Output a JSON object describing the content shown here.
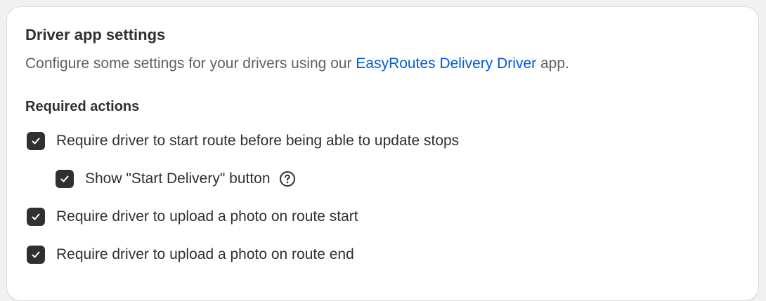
{
  "card": {
    "title": "Driver app settings",
    "description": {
      "prefix": "Configure some settings for your drivers using our ",
      "link": "EasyRoutes Delivery Driver",
      "suffix": " app."
    }
  },
  "required_actions": {
    "title": "Required actions",
    "options": [
      {
        "label": "Require driver to start route before being able to update stops",
        "checked": true
      },
      {
        "label": "Show \"Start Delivery\" button",
        "checked": true,
        "help_icon": "question-circle-icon"
      },
      {
        "label": "Require driver to upload a photo on route start",
        "checked": true
      },
      {
        "label": "Require driver to upload a photo on route end",
        "checked": true
      }
    ]
  },
  "colors": {
    "link": "#005bd3",
    "checkbox": "#303030",
    "text": "#303030",
    "muted_text": "#616161"
  }
}
